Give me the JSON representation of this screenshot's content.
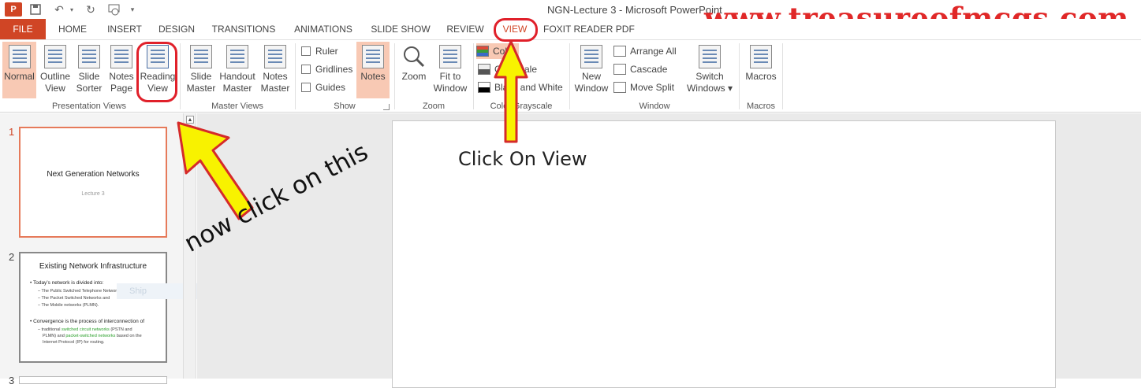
{
  "title": "NGN-Lecture 3 - Microsoft PowerPoint",
  "watermark": "www.treasureofmcqs.com",
  "quick_access": {
    "icons": [
      "powerpoint-logo-icon",
      "save-icon",
      "undo-icon",
      "redo-icon",
      "present-from-start-icon",
      "customize-icon"
    ]
  },
  "tabs": [
    "FILE",
    "HOME",
    "INSERT",
    "DESIGN",
    "TRANSITIONS",
    "ANIMATIONS",
    "SLIDE SHOW",
    "REVIEW",
    "VIEW",
    "FOXIT READER PDF"
  ],
  "ribbon": {
    "presentation_views": {
      "label": "Presentation Views",
      "buttons": [
        "Normal",
        "Outline\nView",
        "Slide\nSorter",
        "Notes\nPage",
        "Reading\nView"
      ]
    },
    "master_views": {
      "label": "Master Views",
      "buttons": [
        "Slide\nMaster",
        "Handout\nMaster",
        "Notes\nMaster"
      ]
    },
    "show": {
      "label": "Show",
      "items": [
        "Ruler",
        "Gridlines",
        "Guides"
      ],
      "notes": "Notes"
    },
    "zoom": {
      "label": "Zoom",
      "buttons": [
        "Zoom",
        "Fit to\nWindow"
      ]
    },
    "color": {
      "label": "Color/Grayscale",
      "items": [
        "Color",
        "Grayscale",
        "Black and White"
      ]
    },
    "window": {
      "label": "Window",
      "new_window": "New\nWindow",
      "items": [
        "Arrange All",
        "Cascade",
        "Move Split"
      ],
      "switch": "Switch\nWindows ▾"
    },
    "macros": {
      "label": "Macros",
      "button": "Macros"
    }
  },
  "slides": {
    "s1": {
      "num": "1",
      "title": "Next Generation Networks",
      "subtitle": "Lecture 3"
    },
    "s2": {
      "num": "2",
      "title": "Existing Network Infrastructure",
      "b1": "• Today’s network is divided into:",
      "b1s1": "– The Public Switched Telephone Network,",
      "b1s2": "– The Packet Switched Networks and",
      "b1s3": "– The Mobile networks (PLMN).",
      "b2": "• Convergence is the process of interconnection of",
      "b2s1a": "– traditional ",
      "b2s1b": "switched circuit networks",
      "b2s1c": " (PSTN and",
      "b2s2a": "PLMN) and ",
      "b2s2b": "packet-switched networks",
      "b2s2c": " based on the",
      "b2s3": "Internet Protocol (IP) for routing."
    },
    "s3": {
      "num": "3"
    }
  },
  "ghost_text": "Ship",
  "annotations": {
    "click_view": "Click On View",
    "click_this": "now click on this"
  }
}
